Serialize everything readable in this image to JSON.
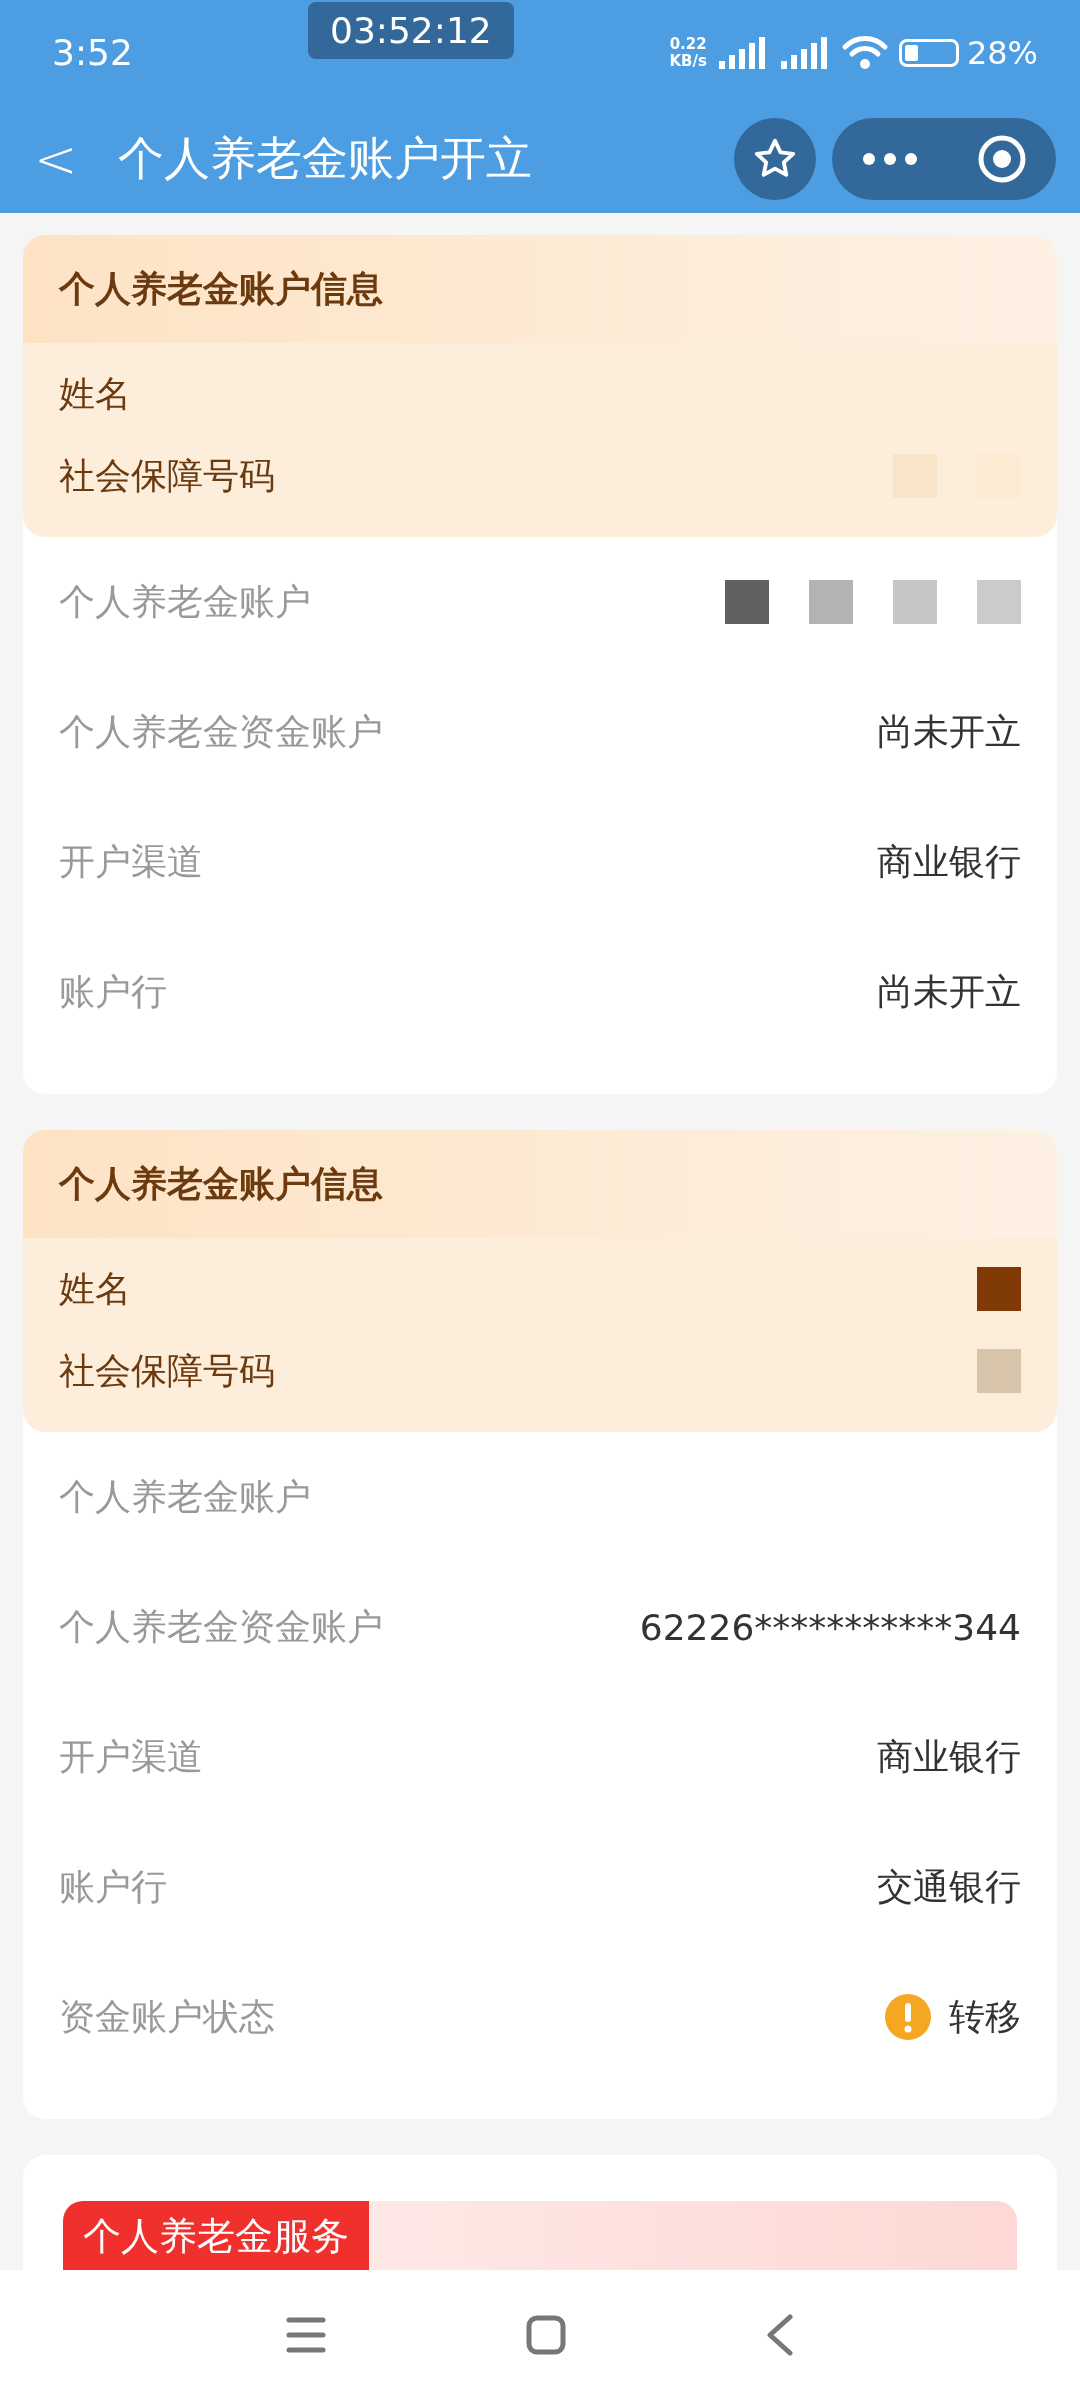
{
  "status_bar": {
    "time": "3:52",
    "recorder": "03:52:12",
    "speed_value": "0.22",
    "speed_unit": "KB/s",
    "battery_percent": "28%"
  },
  "header": {
    "back": "<",
    "title": "个人养老金账户开立"
  },
  "cards": [
    {
      "title": "个人养老金账户信息",
      "highlight_rows": [
        {
          "label": "姓名",
          "masks": []
        },
        {
          "label": "社会保障号码",
          "masks": [
            {
              "color": "#fae4c8"
            },
            {
              "color": "#fcebd2"
            }
          ]
        }
      ],
      "rows": [
        {
          "label": "个人养老金账户",
          "masks": [
            {
              "color": "#616161"
            },
            {
              "color": "#b3b3b3"
            },
            {
              "color": "#c6c6c6"
            },
            {
              "color": "#cbcbcb"
            }
          ]
        },
        {
          "label": "个人养老金资金账户",
          "value": "尚未开立",
          "masks": []
        },
        {
          "label": "开户渠道",
          "value": "商业银行",
          "masks": []
        },
        {
          "label": "账户行",
          "value": "尚未开立",
          "masks": []
        }
      ]
    },
    {
      "title": "个人养老金账户信息",
      "highlight_rows": [
        {
          "label": "姓名",
          "masks": [
            {
              "color": "#7f3a05"
            }
          ]
        },
        {
          "label": "社会保障号码",
          "masks": [
            {
              "color": "#d8c4aa"
            }
          ]
        }
      ],
      "rows": [
        {
          "label": "个人养老金账户",
          "masks": []
        },
        {
          "label": "个人养老金资金账户",
          "value": "62226***********344",
          "masks": []
        },
        {
          "label": "开户渠道",
          "value": "商业银行",
          "masks": []
        },
        {
          "label": "账户行",
          "value": "交通银行",
          "masks": []
        },
        {
          "label": "资金账户状态",
          "value": "转移",
          "warning": true,
          "masks": []
        }
      ]
    }
  ],
  "service_banner": {
    "tag": "个人养老金服务"
  }
}
